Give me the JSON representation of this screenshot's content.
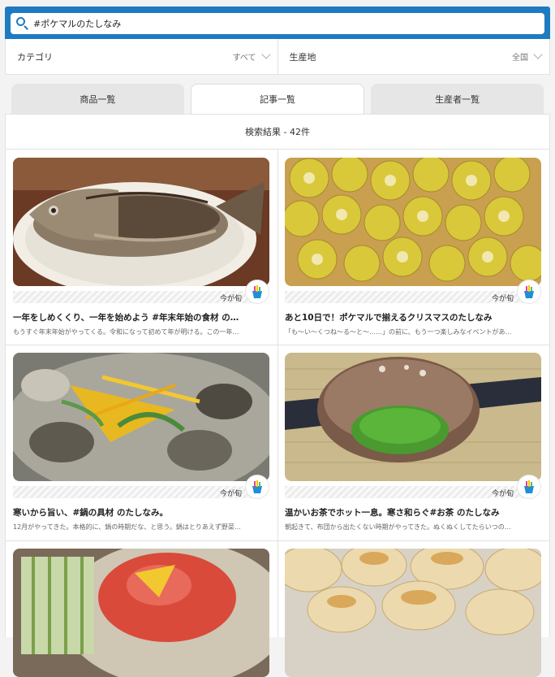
{
  "search": {
    "value": "#ポケマルのたしなみ"
  },
  "filters": {
    "category": {
      "label": "カテゴリ",
      "value": "すべて"
    },
    "origin": {
      "label": "生産地",
      "value": "全国"
    }
  },
  "tabs": [
    {
      "label": "商品一覧"
    },
    {
      "label": "記事一覧"
    },
    {
      "label": "生産者一覧"
    }
  ],
  "results_text": "検索結果 - 42件",
  "articles": [
    {
      "season": "今が旬",
      "title": "一年をしめくくり、一年を始めよう #年末年始の食材 の…",
      "desc": "もうすぐ年末年始がやってくる。令和になって初めて年が明ける。この一年…",
      "image": "grilled-sea-bream"
    },
    {
      "season": "今が旬",
      "title": "あと10日で！ポケマルで揃えるクリスマスのたしなみ",
      "desc": "「も〜い〜くつね〜る〜と〜……」の前に、もう一つ楽しみなイベントがあ…",
      "image": "kiwi-tart"
    },
    {
      "season": "今が旬",
      "title": "寒いから旨い、#鍋の具材 のたしなみ。",
      "desc": "12月がやってきた。本格的に、鍋の時期だな、と思う。鍋はとりあえず野菜…",
      "image": "oyster-hotpot"
    },
    {
      "season": "今が旬",
      "title": "温かいお茶でホット一息。寒さ和らぐ#お茶 のたしなみ",
      "desc": "朝起きて、布団から出たくない時期がやってきた。ぬくぬくしてたらいつの…",
      "image": "matcha-bowl"
    },
    {
      "image": "vegetable-dish"
    },
    {
      "image": "baked-buns"
    }
  ]
}
